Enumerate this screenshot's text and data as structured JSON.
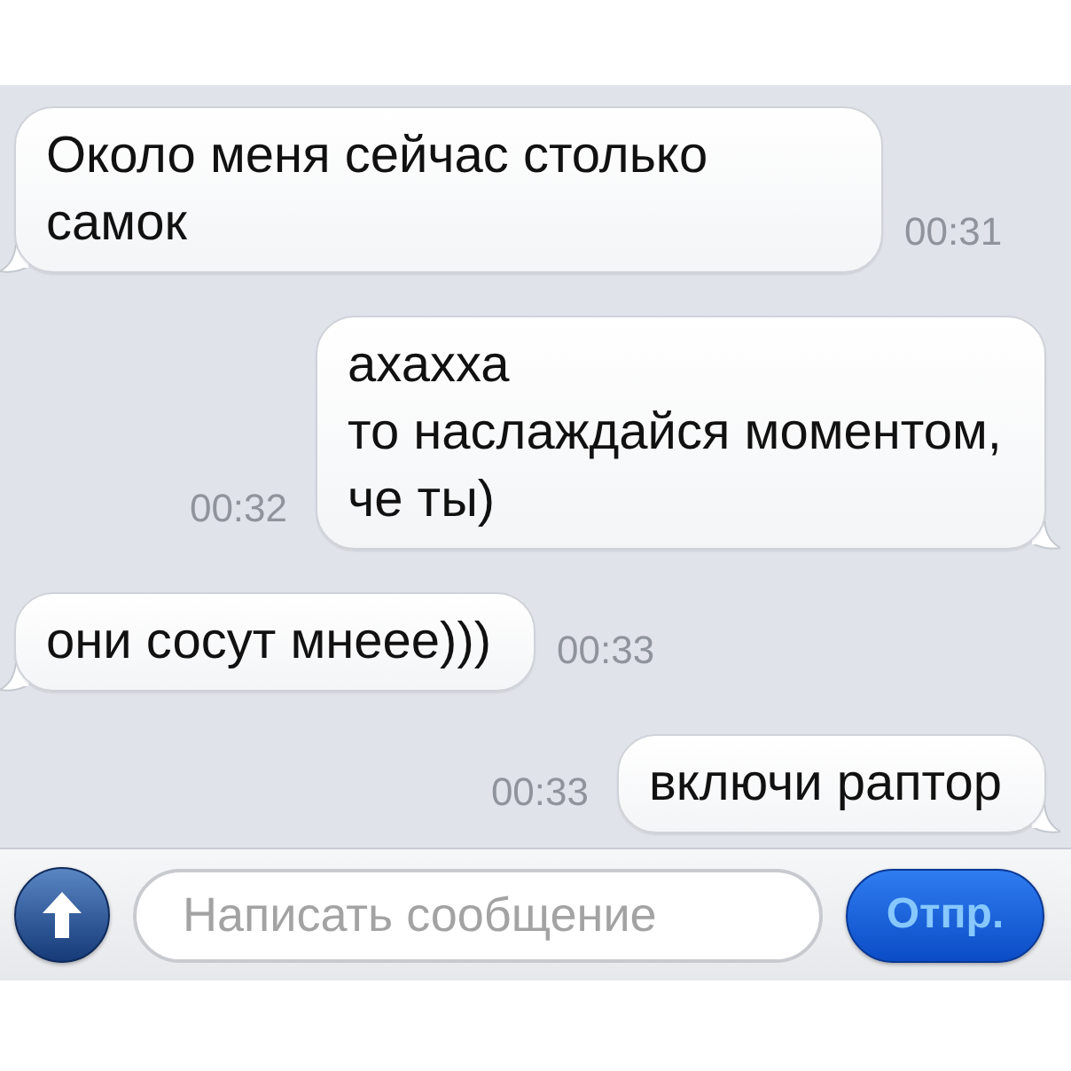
{
  "messages": [
    {
      "kind": "incoming",
      "text": "Около меня сейчас столько самок",
      "time": "00:31"
    },
    {
      "kind": "outgoing",
      "text": "ахахха\nто наслаждайся моментом,\nче ты)",
      "time": "00:32"
    },
    {
      "kind": "incoming",
      "text": "они сосут мнеее)))",
      "time": "00:33"
    },
    {
      "kind": "outgoing",
      "text": "включи раптор",
      "time": "00:33"
    }
  ],
  "composer": {
    "placeholder": "Написать сообщение",
    "send_label": "Отпр."
  }
}
